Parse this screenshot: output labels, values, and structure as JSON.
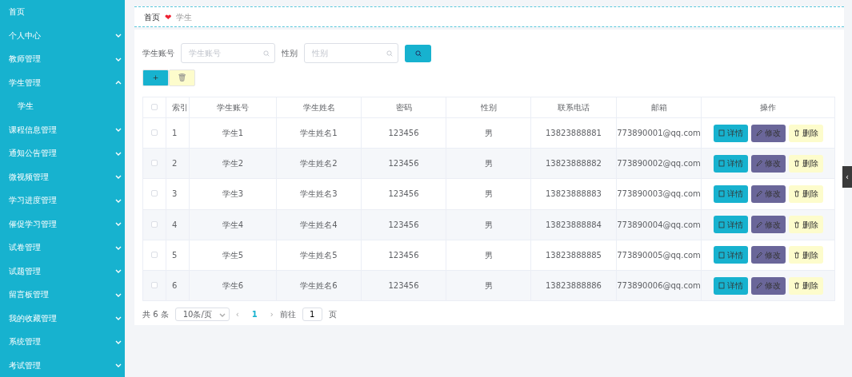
{
  "sidebar": {
    "items": [
      {
        "label": "首页"
      },
      {
        "label": "个人中心",
        "expanded": false
      },
      {
        "label": "教师管理",
        "expanded": false
      },
      {
        "label": "学生管理",
        "expanded": true,
        "children": [
          {
            "label": "学生"
          }
        ]
      },
      {
        "label": "课程信息管理",
        "expanded": false
      },
      {
        "label": "通知公告管理",
        "expanded": false
      },
      {
        "label": "微视频管理",
        "expanded": false
      },
      {
        "label": "学习进度管理",
        "expanded": false
      },
      {
        "label": "催促学习管理",
        "expanded": false
      },
      {
        "label": "试卷管理",
        "expanded": false
      },
      {
        "label": "试题管理",
        "expanded": false
      },
      {
        "label": "留言板管理",
        "expanded": false
      },
      {
        "label": "我的收藏管理",
        "expanded": false
      },
      {
        "label": "系统管理",
        "expanded": false
      },
      {
        "label": "考试管理",
        "expanded": false
      }
    ]
  },
  "breadcrumb": {
    "home": "首页",
    "separator": "❤",
    "current": "学生"
  },
  "search": {
    "fields": [
      {
        "label": "学生账号",
        "placeholder": "学生账号"
      },
      {
        "label": "性别",
        "placeholder": "性别"
      }
    ]
  },
  "toolbar": {
    "add": "+",
    "delete": "🗑"
  },
  "table": {
    "select_all": {
      "checked": false
    },
    "columns": [
      "索引",
      "学生账号",
      "学生姓名",
      "密码",
      "性别",
      "联系电话",
      "邮箱",
      "操作"
    ],
    "rows": [
      {
        "checked": false,
        "cells": [
          "1",
          "学生1",
          "学生姓名1",
          "123456",
          "男",
          "13823888881",
          "773890001@qq.com"
        ],
        "actions": [
          {
            "kind": "detail",
            "label": "详情"
          },
          {
            "kind": "edit",
            "label": "修改"
          },
          {
            "kind": "delete",
            "label": "删除"
          }
        ]
      },
      {
        "checked": false,
        "cells": [
          "2",
          "学生2",
          "学生姓名2",
          "123456",
          "男",
          "13823888882",
          "773890002@qq.com"
        ],
        "actions": [
          {
            "kind": "detail",
            "label": "详情"
          },
          {
            "kind": "edit",
            "label": "修改"
          },
          {
            "kind": "delete",
            "label": "删除"
          }
        ]
      },
      {
        "checked": false,
        "cells": [
          "3",
          "学生3",
          "学生姓名3",
          "123456",
          "男",
          "13823888883",
          "773890003@qq.com"
        ],
        "actions": [
          {
            "kind": "detail",
            "label": "详情"
          },
          {
            "kind": "edit",
            "label": "修改"
          },
          {
            "kind": "delete",
            "label": "删除"
          }
        ]
      },
      {
        "checked": false,
        "cells": [
          "4",
          "学生4",
          "学生姓名4",
          "123456",
          "男",
          "13823888884",
          "773890004@qq.com"
        ],
        "actions": [
          {
            "kind": "detail",
            "label": "详情"
          },
          {
            "kind": "edit",
            "label": "修改"
          },
          {
            "kind": "delete",
            "label": "删除"
          }
        ]
      },
      {
        "checked": false,
        "cells": [
          "5",
          "学生5",
          "学生姓名5",
          "123456",
          "男",
          "13823888885",
          "773890005@qq.com"
        ],
        "actions": [
          {
            "kind": "detail",
            "label": "详情"
          },
          {
            "kind": "edit",
            "label": "修改"
          },
          {
            "kind": "delete",
            "label": "删除"
          }
        ]
      },
      {
        "checked": false,
        "cells": [
          "6",
          "学生6",
          "学生姓名6",
          "123456",
          "男",
          "13823888886",
          "773890006@qq.com"
        ],
        "actions": [
          {
            "kind": "detail",
            "label": "详情"
          },
          {
            "kind": "edit",
            "label": "修改"
          },
          {
            "kind": "delete",
            "label": "删除"
          }
        ]
      }
    ]
  },
  "pagination": {
    "total": "共 6 条",
    "page_size": "10条/页",
    "prev": "‹",
    "pages": [
      {
        "label": "1",
        "selected": true
      }
    ],
    "next": "›",
    "goto_label": "前往",
    "goto_value": "1",
    "page_suffix": "页"
  },
  "collapse_tab": {
    "label": "‹"
  }
}
